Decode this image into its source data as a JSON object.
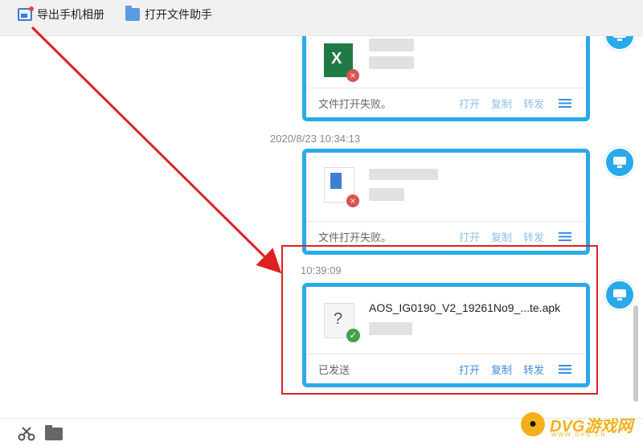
{
  "toolbar": {
    "export_album_label": "导出手机相册",
    "open_file_helper_label": "打开文件助手"
  },
  "messages": [
    {
      "file_type": "excel",
      "thumb_letter": "X",
      "status": "文件打开失败。",
      "actions": [
        "打开",
        "复制",
        "转发"
      ]
    },
    {
      "timestamp": "2020/8/23 10:34:13",
      "file_type": "zip",
      "status": "文件打开失败。",
      "actions": [
        "打开",
        "复制",
        "转发"
      ]
    },
    {
      "timestamp": "10:39:09",
      "file_type": "unknown",
      "thumb_symbol": "?",
      "filename": "AOS_IG0190_V2_19261No9_...te.apk",
      "status": "已发送",
      "actions": [
        "打开",
        "复制",
        "转发"
      ]
    }
  ],
  "watermark": {
    "text": "DVG游戏网",
    "sub": "WWW.DVG.CN"
  },
  "colors": {
    "accent": "#29aae8",
    "highlight": "#e02020",
    "link": "#3a8ee6"
  }
}
